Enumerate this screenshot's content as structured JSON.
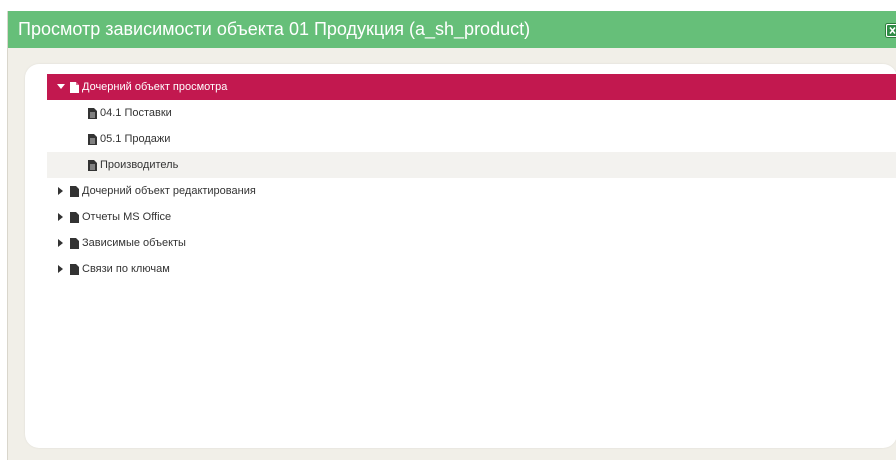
{
  "window": {
    "title": "Просмотр зависимости объекта 01 Продукция (a_sh_product)",
    "title_button_icon": "excel-export-icon"
  },
  "colors": {
    "titlebar": "#66bf79",
    "selected": "#c2184f",
    "background": "#f1efe8"
  },
  "tree": {
    "items": [
      {
        "label": "Дочерний объект просмотра",
        "expanded": true,
        "selected": true,
        "icon": "document-icon",
        "children": [
          {
            "label": "04.1 Поставки",
            "icon": "document-icon"
          },
          {
            "label": "05.1 Продажи",
            "icon": "document-icon"
          },
          {
            "label": "Производитель",
            "icon": "document-icon",
            "hovered": true
          }
        ]
      },
      {
        "label": "Дочерний объект редактирования",
        "expanded": false,
        "icon": "document-icon"
      },
      {
        "label": "Отчеты MS Office",
        "expanded": false,
        "icon": "document-icon"
      },
      {
        "label": "Зависимые объекты",
        "expanded": false,
        "icon": "document-icon"
      },
      {
        "label": "Связи по ключам",
        "expanded": false,
        "icon": "document-icon"
      }
    ]
  }
}
